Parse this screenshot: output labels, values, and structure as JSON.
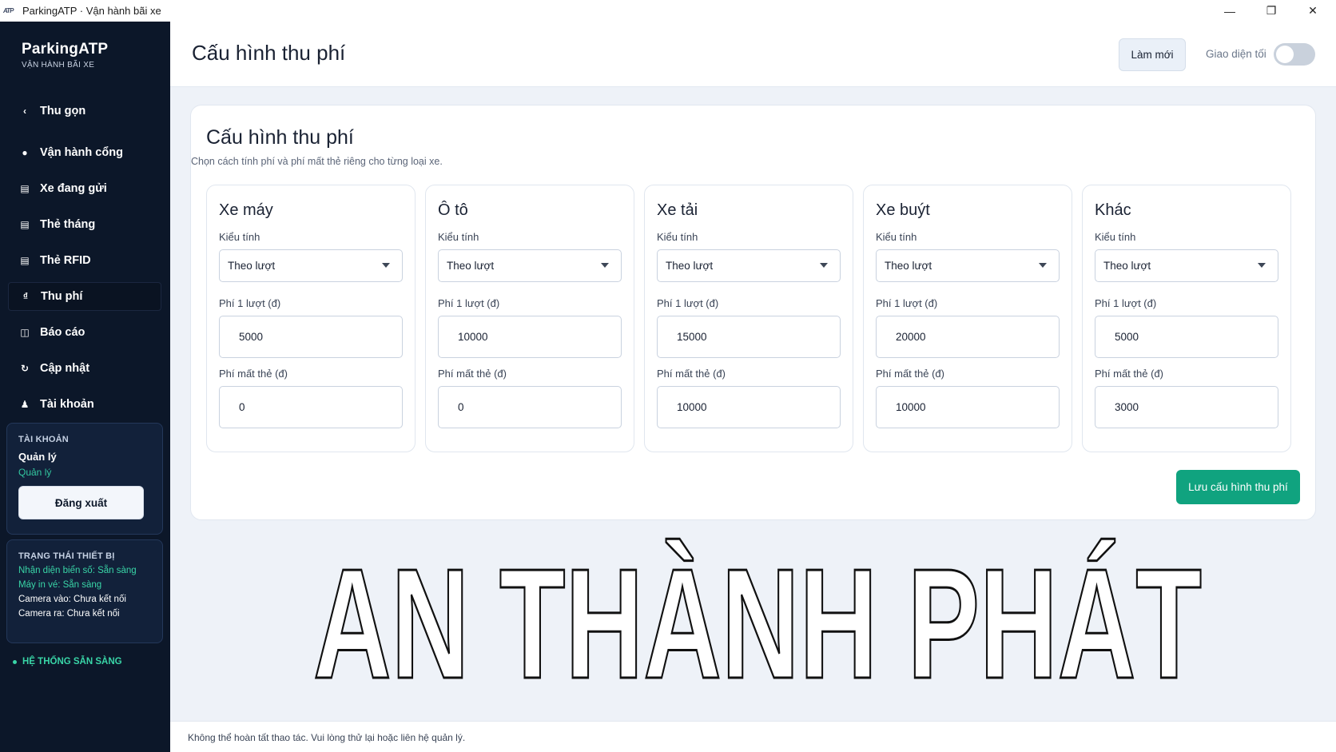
{
  "window": {
    "title": "ParkingATP · Vận hành bãi xe",
    "logo_text": "ATP"
  },
  "sidebar": {
    "brand_name": "ParkingATP",
    "brand_sub": "VẬN HÀNH BÃI XE",
    "collapse_label": "Thu gọn",
    "items": [
      {
        "label": "Vận hành cổng",
        "icon": "circle-icon"
      },
      {
        "label": "Xe đang gửi",
        "icon": "car-list-icon"
      },
      {
        "label": "Thẻ tháng",
        "icon": "calendar-card-icon"
      },
      {
        "label": "Thẻ RFID",
        "icon": "rfid-card-icon"
      },
      {
        "label": "Thu phí",
        "icon": "dong-sign-icon"
      },
      {
        "label": "Báo cáo",
        "icon": "report-icon"
      },
      {
        "label": "Cập nhật",
        "icon": "refresh-icon"
      },
      {
        "label": "Tài khoản",
        "icon": "user-icon"
      }
    ],
    "active": "Thu phí",
    "account": {
      "heading": "TÀI KHOẢN",
      "name": "Quản lý",
      "role": "Quản lý",
      "logout_label": "Đăng xuất"
    },
    "devices": {
      "heading": "TRẠNG THÁI THIẾT BỊ",
      "lines": [
        {
          "text": "Nhận diện biển số: Sẵn sàng",
          "status": "ok"
        },
        {
          "text": "Máy in vé: Sẵn sàng",
          "status": "ok"
        },
        {
          "text": "Camera vào: Chưa kết nối",
          "status": "none"
        },
        {
          "text": "Camera ra: Chưa kết nối",
          "status": "none"
        }
      ]
    },
    "system_status": "HỆ THỐNG SẴN SÀNG"
  },
  "header": {
    "title": "Cấu hình thu phí",
    "refresh_label": "Làm mới",
    "dark_mode_label": "Giao diện tối",
    "dark_mode_on": false
  },
  "config": {
    "title": "Cấu hình thu phí",
    "description": "Chọn cách tính phí và phí mất thẻ riêng cho từng loại xe.",
    "method_label": "Kiểu tính",
    "fee_label": "Phí 1 lượt (đ)",
    "lost_label": "Phí mất thẻ (đ)",
    "vehicles": [
      {
        "name": "Xe máy",
        "method": "Theo lượt",
        "fee": "5000",
        "lost": "0"
      },
      {
        "name": "Ô tô",
        "method": "Theo lượt",
        "fee": "10000",
        "lost": "0"
      },
      {
        "name": "Xe tải",
        "method": "Theo lượt",
        "fee": "15000",
        "lost": "10000"
      },
      {
        "name": "Xe buýt",
        "method": "Theo lượt",
        "fee": "20000",
        "lost": "10000"
      },
      {
        "name": "Khác",
        "method": "Theo lượt",
        "fee": "5000",
        "lost": "3000"
      }
    ],
    "save_label": "Lưu cấu hình thu phí"
  },
  "watermark": "AN THÀNH PHÁT",
  "footer": {
    "message": "Không thể hoàn tất thao tác. Vui lòng thử lại hoặc liên hệ quản lý."
  },
  "colors": {
    "sidebar_bg": "#0c1729",
    "accent_green": "#10a37f",
    "status_green": "#39d5a7"
  }
}
